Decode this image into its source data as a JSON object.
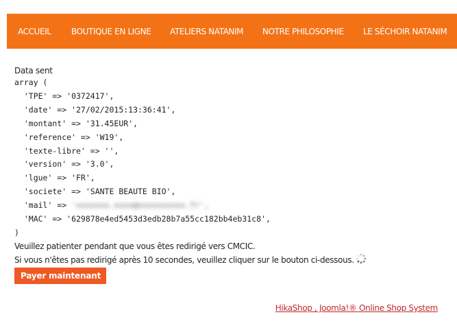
{
  "nav": {
    "items": [
      {
        "label": "ACCUEIL"
      },
      {
        "label": "BOUTIQUE EN LIGNE"
      },
      {
        "label": "ATELIERS NATANIM"
      },
      {
        "label": "NOTRE PHILOSOPHIE"
      },
      {
        "label": "LE SÉCHOIR NATANIM"
      }
    ],
    "bg_color": "#f47216"
  },
  "debug": {
    "heading": "Data sent",
    "open": "array (",
    "lines": [
      "  'TPE' => '0372417',",
      "  'date' => '27/02/2015:13:36:41',",
      "  'montant' => '31.45EUR',",
      "  'reference' => 'W19',",
      "  'texte-libre' => '',",
      "  'version' => '3.0',",
      "  'lgue' => 'FR',",
      "  'societe' => 'SANTE BEAUTE BIO',"
    ],
    "mail_key": "  'mail' => ",
    "mail_value": "'xxxxxxx.xxxx@xxxxxxxxxx.fr',",
    "mac_line": "  'MAC' => '629878e4ed5453d3edb28b7a55cc182bb4eb31c8',",
    "close": ")"
  },
  "messages": {
    "wait": "Veuillez patienter pendant que vous êtes redirigé vers CMCIC.",
    "fallback": "Si vous n'êtes pas redirigé après 10 secondes, veuillez cliquer sur le bouton ci-dessous."
  },
  "pay_button": {
    "label": "Payer maintenant",
    "color": "#ee5a24"
  },
  "footer": {
    "link": "HikaShop , Joomla!® Online Shop System",
    "color": "#c0282d"
  },
  "icons": {
    "spinner": "loading-spinner-icon"
  }
}
